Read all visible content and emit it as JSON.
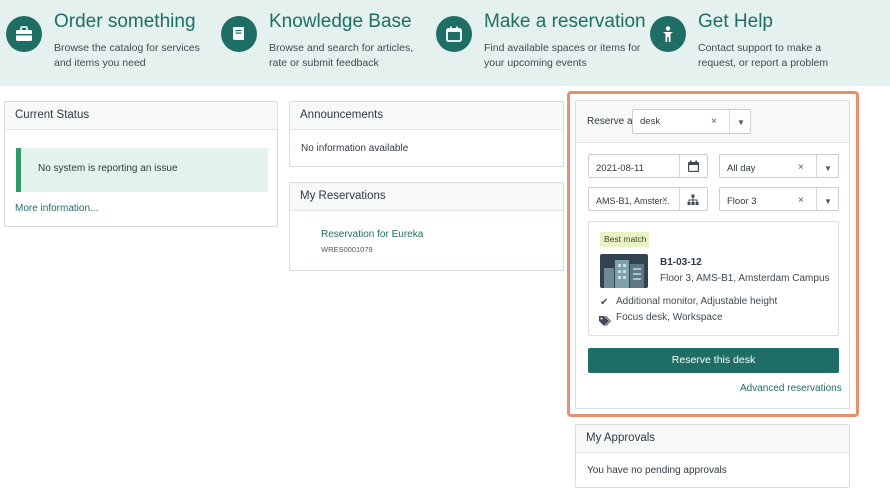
{
  "banner": {
    "order": {
      "title": "Order something",
      "desc": "Browse the catalog for services and items you need"
    },
    "knowledge": {
      "title": "Knowledge Base",
      "desc": "Browse and search for articles, rate or submit feedback"
    },
    "reservation": {
      "title": "Make a reservation",
      "desc": "Find available spaces or items for your upcoming events"
    },
    "help": {
      "title": "Get Help",
      "desc": "Contact support to make a request, or report a problem"
    }
  },
  "current_status": {
    "title": "Current Status",
    "message": "No system is reporting an issue",
    "more_link": "More information..."
  },
  "announcements": {
    "title": "Announcements",
    "message": "No information available"
  },
  "my_reservations": {
    "title": "My Reservations",
    "item_title": "Reservation for Eureka",
    "item_number": "WRES0001079"
  },
  "reserve_widget": {
    "reserve_label": "Reserve a",
    "type_value": "desk",
    "date_value": "2021-08-11",
    "time_value": "All day",
    "location_value": "AMS-B1, Amster...",
    "floor_value": "Floor 3",
    "badge": "Best match",
    "desk_name": "B1-03-12",
    "desk_location": "Floor 3, AMS-B1, Amsterdam Campus",
    "features": "Additional monitor, Adjustable height",
    "tags": "Focus desk, Workspace",
    "reserve_button": "Reserve this desk",
    "advanced_link": "Advanced reservations"
  },
  "my_approvals": {
    "title": "My Approvals",
    "message": "You have no pending approvals"
  },
  "colors": {
    "brand": "#1f6e66",
    "banner_bg": "#e4f1ee",
    "highlight": "#e8906d",
    "success": "#2e9b6b"
  },
  "icons": {
    "order": "briefcase-icon",
    "knowledge": "book-icon",
    "reservation": "calendar-icon",
    "help": "person-help-icon"
  }
}
